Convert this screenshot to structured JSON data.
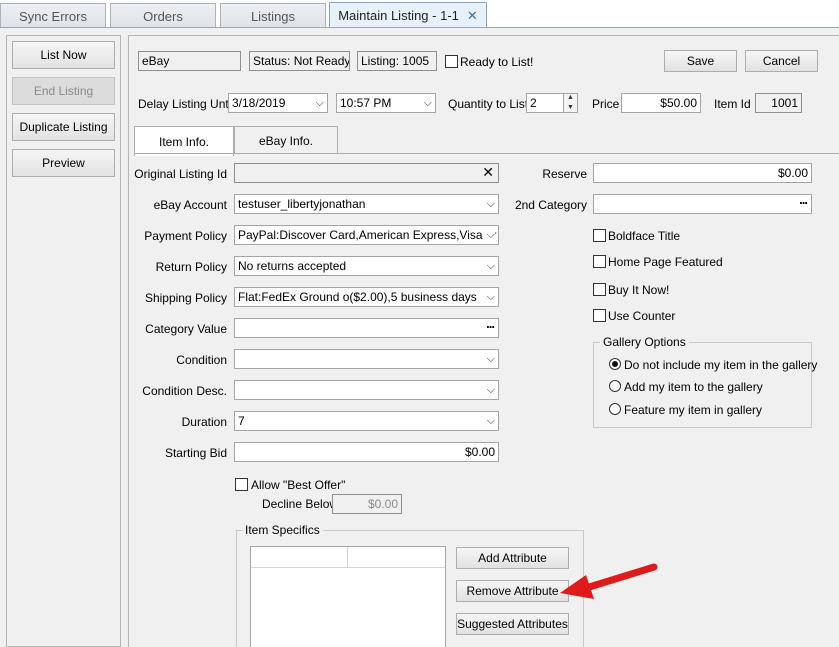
{
  "tabs": [
    {
      "label": "Sync Errors"
    },
    {
      "label": "Orders"
    },
    {
      "label": "Listings"
    },
    {
      "label": "Maintain Listing - 1-1"
    }
  ],
  "left_buttons": {
    "list_now": "List Now",
    "end_listing": "End Listing",
    "duplicate_listing": "Duplicate Listing",
    "preview": "Preview"
  },
  "header": {
    "site": "eBay",
    "status": "Status: Not Ready",
    "listing": "Listing: 1005",
    "ready_label": "Ready to List!",
    "save": "Save",
    "cancel": "Cancel",
    "delay_label": "Delay Listing Until",
    "delay_date": "3/18/2019",
    "delay_time": "10:57 PM",
    "qty_label": "Quantity to List",
    "qty_value": "2",
    "price_label": "Price",
    "price_value": "$50.00",
    "item_id_label": "Item Id",
    "item_id_value": "1001"
  },
  "inner_tabs": {
    "item_info": "Item Info.",
    "ebay_info": "eBay Info."
  },
  "form": {
    "original_listing_label": "Original Listing Id",
    "original_listing_value": "",
    "ebay_account_label": "eBay Account",
    "ebay_account_value": "testuser_libertyjonathan",
    "payment_policy_label": "Payment Policy",
    "payment_policy_value": "PayPal:Discover Card,American Express,Visa or",
    "return_policy_label": "Return Policy",
    "return_policy_value": "No returns accepted",
    "shipping_policy_label": "Shipping Policy",
    "shipping_policy_value": "Flat:FedEx Ground o($2.00),5 business days",
    "category_value_label": "Category Value",
    "category_value": "",
    "condition_label": "Condition",
    "condition_value": "",
    "condition_desc_label": "Condition Desc.",
    "condition_desc_value": "",
    "duration_label": "Duration",
    "duration_value": "7",
    "starting_bid_label": "Starting Bid",
    "starting_bid_value": "$0.00",
    "allow_best_offer": "Allow \"Best Offer\"",
    "decline_below_label": "Decline Below",
    "decline_below_value": "$0.00"
  },
  "right": {
    "reserve_label": "Reserve",
    "reserve_value": "$0.00",
    "second_category_label": "2nd Category",
    "second_category_value": "",
    "boldface": "Boldface Title",
    "home_page": "Home Page Featured",
    "buy_it_now": "Buy It Now!",
    "use_counter": "Use Counter",
    "gallery_title": "Gallery Options",
    "gallery_opt1": "Do not include my item in the gallery",
    "gallery_opt2": "Add my item to the gallery",
    "gallery_opt3": "Feature my item in gallery"
  },
  "specifics": {
    "title": "Item Specifics",
    "add": "Add Attribute",
    "remove": "Remove Attribute",
    "suggested": "Suggested Attributes"
  },
  "colors": {
    "annotation_arrow": "#e0191b",
    "active_tab": "#e7f1fb"
  }
}
